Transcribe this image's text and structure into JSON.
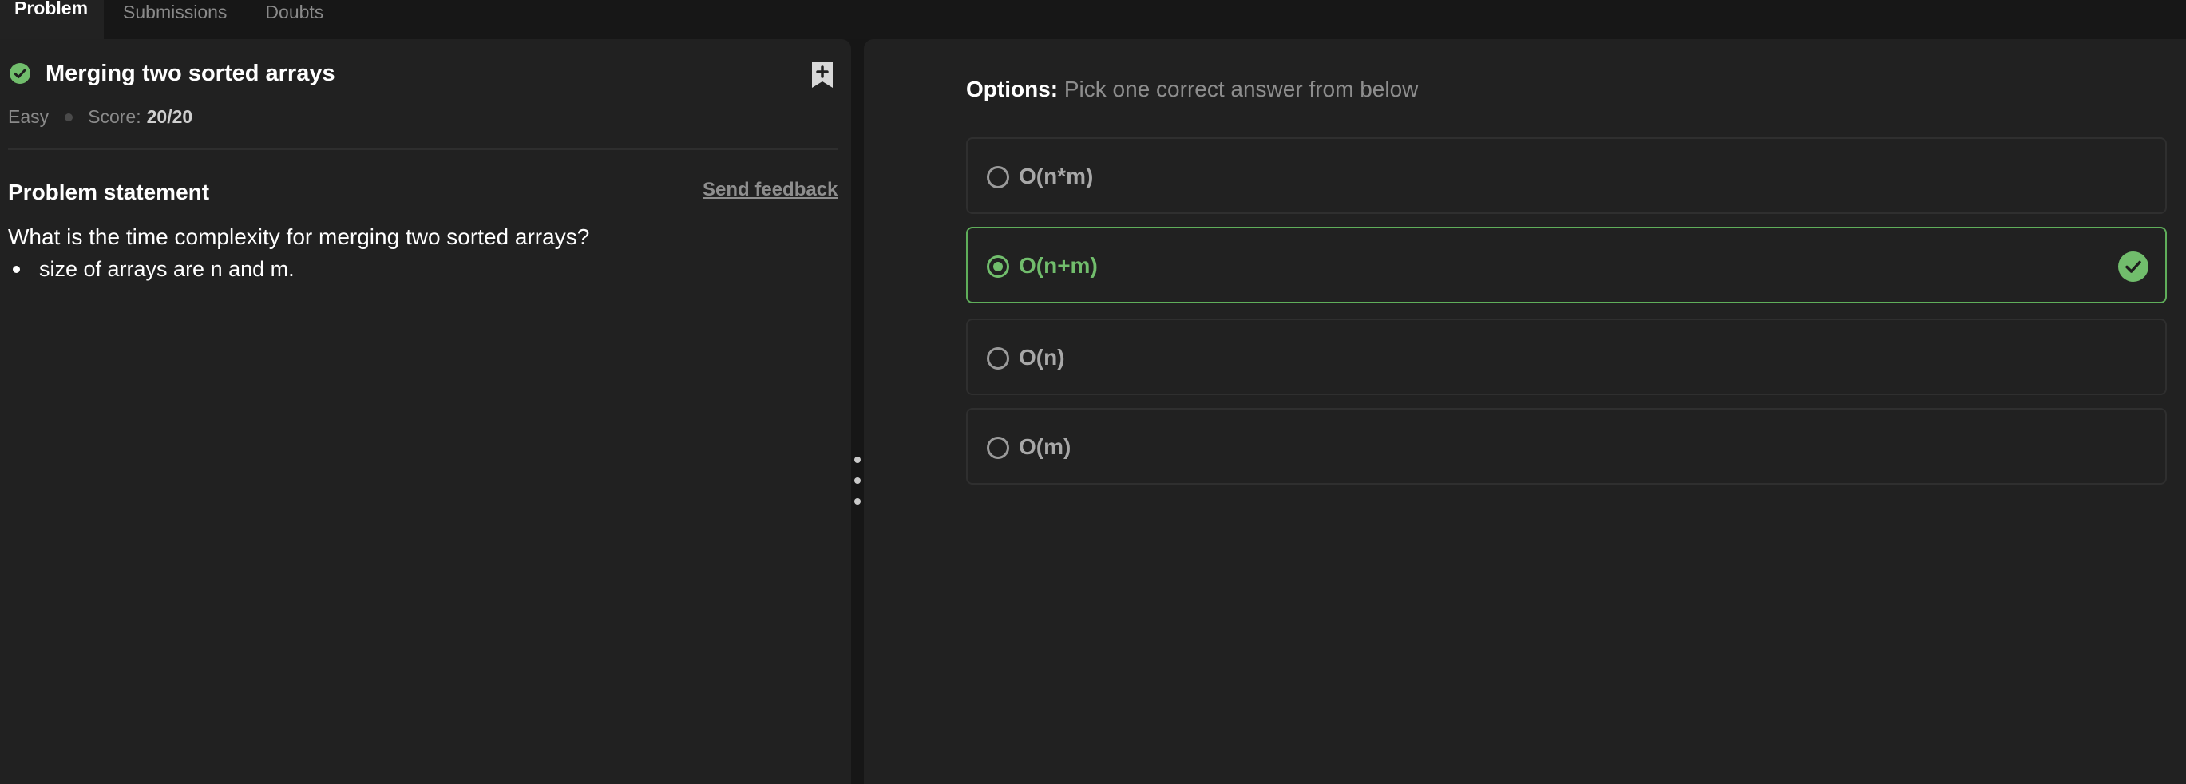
{
  "tabs": [
    {
      "label": "Problem",
      "active": true
    },
    {
      "label": "Submissions",
      "active": false
    },
    {
      "label": "Doubts",
      "active": false
    }
  ],
  "problem": {
    "title": "Merging two sorted arrays",
    "difficulty": "Easy",
    "score_label": "Score:",
    "score_value": "20/20",
    "statement_heading": "Problem statement",
    "feedback_link": "Send feedback",
    "question": "What is the time complexity for merging two sorted arrays?",
    "bullets": [
      "size of arrays are n and m."
    ]
  },
  "options_panel": {
    "label_bold": "Options:",
    "label_rest": " Pick one correct answer from below",
    "options": [
      {
        "text": "O(n*m)",
        "selected": false,
        "correct": false
      },
      {
        "text": "O(n+m)",
        "selected": true,
        "correct": true
      },
      {
        "text": "O(n)",
        "selected": false,
        "correct": false
      },
      {
        "text": "O(m)",
        "selected": false,
        "correct": false
      }
    ]
  },
  "colors": {
    "success": "#71bd6c",
    "panel_bg": "#212121",
    "page_bg": "#161616"
  },
  "icons": {
    "solved": "check-circle-icon",
    "bookmark": "bookmark-add-icon",
    "correct": "check-circle-icon",
    "divider": "drag-handle-icon"
  }
}
